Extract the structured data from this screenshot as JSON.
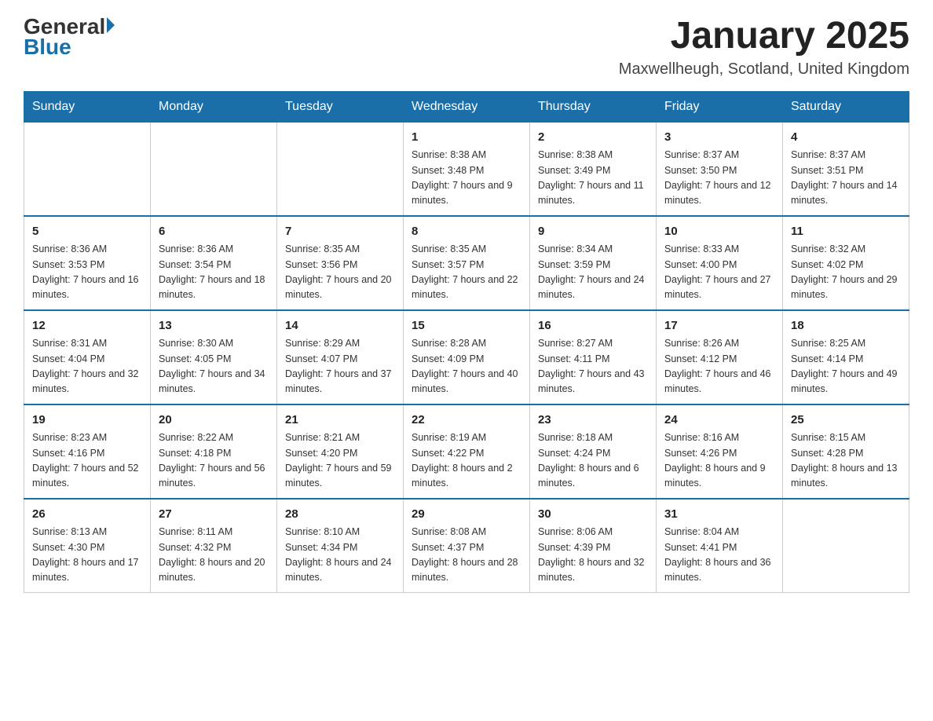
{
  "header": {
    "logo_general": "General",
    "logo_blue": "Blue",
    "month_title": "January 2025",
    "location": "Maxwellheugh, Scotland, United Kingdom"
  },
  "days_of_week": [
    "Sunday",
    "Monday",
    "Tuesday",
    "Wednesday",
    "Thursday",
    "Friday",
    "Saturday"
  ],
  "weeks": [
    [
      {
        "day": "",
        "info": ""
      },
      {
        "day": "",
        "info": ""
      },
      {
        "day": "",
        "info": ""
      },
      {
        "day": "1",
        "info": "Sunrise: 8:38 AM\nSunset: 3:48 PM\nDaylight: 7 hours and 9 minutes."
      },
      {
        "day": "2",
        "info": "Sunrise: 8:38 AM\nSunset: 3:49 PM\nDaylight: 7 hours and 11 minutes."
      },
      {
        "day": "3",
        "info": "Sunrise: 8:37 AM\nSunset: 3:50 PM\nDaylight: 7 hours and 12 minutes."
      },
      {
        "day": "4",
        "info": "Sunrise: 8:37 AM\nSunset: 3:51 PM\nDaylight: 7 hours and 14 minutes."
      }
    ],
    [
      {
        "day": "5",
        "info": "Sunrise: 8:36 AM\nSunset: 3:53 PM\nDaylight: 7 hours and 16 minutes."
      },
      {
        "day": "6",
        "info": "Sunrise: 8:36 AM\nSunset: 3:54 PM\nDaylight: 7 hours and 18 minutes."
      },
      {
        "day": "7",
        "info": "Sunrise: 8:35 AM\nSunset: 3:56 PM\nDaylight: 7 hours and 20 minutes."
      },
      {
        "day": "8",
        "info": "Sunrise: 8:35 AM\nSunset: 3:57 PM\nDaylight: 7 hours and 22 minutes."
      },
      {
        "day": "9",
        "info": "Sunrise: 8:34 AM\nSunset: 3:59 PM\nDaylight: 7 hours and 24 minutes."
      },
      {
        "day": "10",
        "info": "Sunrise: 8:33 AM\nSunset: 4:00 PM\nDaylight: 7 hours and 27 minutes."
      },
      {
        "day": "11",
        "info": "Sunrise: 8:32 AM\nSunset: 4:02 PM\nDaylight: 7 hours and 29 minutes."
      }
    ],
    [
      {
        "day": "12",
        "info": "Sunrise: 8:31 AM\nSunset: 4:04 PM\nDaylight: 7 hours and 32 minutes."
      },
      {
        "day": "13",
        "info": "Sunrise: 8:30 AM\nSunset: 4:05 PM\nDaylight: 7 hours and 34 minutes."
      },
      {
        "day": "14",
        "info": "Sunrise: 8:29 AM\nSunset: 4:07 PM\nDaylight: 7 hours and 37 minutes."
      },
      {
        "day": "15",
        "info": "Sunrise: 8:28 AM\nSunset: 4:09 PM\nDaylight: 7 hours and 40 minutes."
      },
      {
        "day": "16",
        "info": "Sunrise: 8:27 AM\nSunset: 4:11 PM\nDaylight: 7 hours and 43 minutes."
      },
      {
        "day": "17",
        "info": "Sunrise: 8:26 AM\nSunset: 4:12 PM\nDaylight: 7 hours and 46 minutes."
      },
      {
        "day": "18",
        "info": "Sunrise: 8:25 AM\nSunset: 4:14 PM\nDaylight: 7 hours and 49 minutes."
      }
    ],
    [
      {
        "day": "19",
        "info": "Sunrise: 8:23 AM\nSunset: 4:16 PM\nDaylight: 7 hours and 52 minutes."
      },
      {
        "day": "20",
        "info": "Sunrise: 8:22 AM\nSunset: 4:18 PM\nDaylight: 7 hours and 56 minutes."
      },
      {
        "day": "21",
        "info": "Sunrise: 8:21 AM\nSunset: 4:20 PM\nDaylight: 7 hours and 59 minutes."
      },
      {
        "day": "22",
        "info": "Sunrise: 8:19 AM\nSunset: 4:22 PM\nDaylight: 8 hours and 2 minutes."
      },
      {
        "day": "23",
        "info": "Sunrise: 8:18 AM\nSunset: 4:24 PM\nDaylight: 8 hours and 6 minutes."
      },
      {
        "day": "24",
        "info": "Sunrise: 8:16 AM\nSunset: 4:26 PM\nDaylight: 8 hours and 9 minutes."
      },
      {
        "day": "25",
        "info": "Sunrise: 8:15 AM\nSunset: 4:28 PM\nDaylight: 8 hours and 13 minutes."
      }
    ],
    [
      {
        "day": "26",
        "info": "Sunrise: 8:13 AM\nSunset: 4:30 PM\nDaylight: 8 hours and 17 minutes."
      },
      {
        "day": "27",
        "info": "Sunrise: 8:11 AM\nSunset: 4:32 PM\nDaylight: 8 hours and 20 minutes."
      },
      {
        "day": "28",
        "info": "Sunrise: 8:10 AM\nSunset: 4:34 PM\nDaylight: 8 hours and 24 minutes."
      },
      {
        "day": "29",
        "info": "Sunrise: 8:08 AM\nSunset: 4:37 PM\nDaylight: 8 hours and 28 minutes."
      },
      {
        "day": "30",
        "info": "Sunrise: 8:06 AM\nSunset: 4:39 PM\nDaylight: 8 hours and 32 minutes."
      },
      {
        "day": "31",
        "info": "Sunrise: 8:04 AM\nSunset: 4:41 PM\nDaylight: 8 hours and 36 minutes."
      },
      {
        "day": "",
        "info": ""
      }
    ]
  ]
}
